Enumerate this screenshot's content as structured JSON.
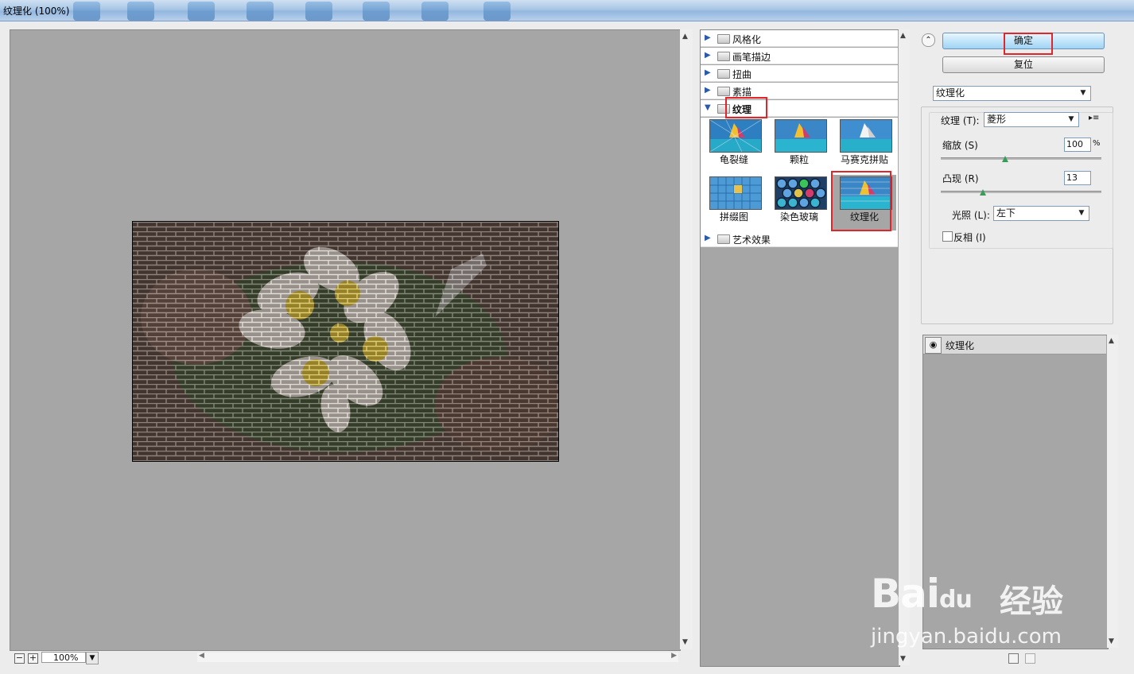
{
  "window": {
    "title": "纹理化 (100%)"
  },
  "preview": {
    "zoom": "100%",
    "zoom_out": "−",
    "zoom_in": "+"
  },
  "gallery": {
    "categories_top": [
      "风格化",
      "画笔描边",
      "扭曲",
      "素描"
    ],
    "expanded_category": "纹理",
    "filters": [
      "龟裂缝",
      "颗粒",
      "马赛克拼贴",
      "拼缀图",
      "染色玻璃",
      "纹理化"
    ],
    "selected_filter": "纹理化",
    "categories_bottom": [
      "艺术效果"
    ]
  },
  "buttons": {
    "ok": "确定",
    "reset": "复位"
  },
  "filter_select": "纹理化",
  "settings": {
    "texture_label": "纹理 (T):",
    "texture_value": "菱形",
    "scale_label": "缩放 (S)",
    "scale_value": "100",
    "scale_unit": "%",
    "scale_fraction": 0.4,
    "relief_label": "凸现 (R)",
    "relief_value": "13",
    "relief_fraction": 0.26,
    "light_label": "光照 (L):",
    "light_value": "左下",
    "invert_label": "反相 (I)",
    "invert_checked": false
  },
  "layers": {
    "items": [
      "纹理化"
    ]
  },
  "watermark": {
    "brand": "Bai",
    "brand_du": "du",
    "cn": "经验",
    "url": "jingyan.baidu.com"
  },
  "colors": {
    "accent_red": "#e0262a",
    "ok_button": "#9ed4f4",
    "canvas_gray": "#a6a6a6"
  }
}
